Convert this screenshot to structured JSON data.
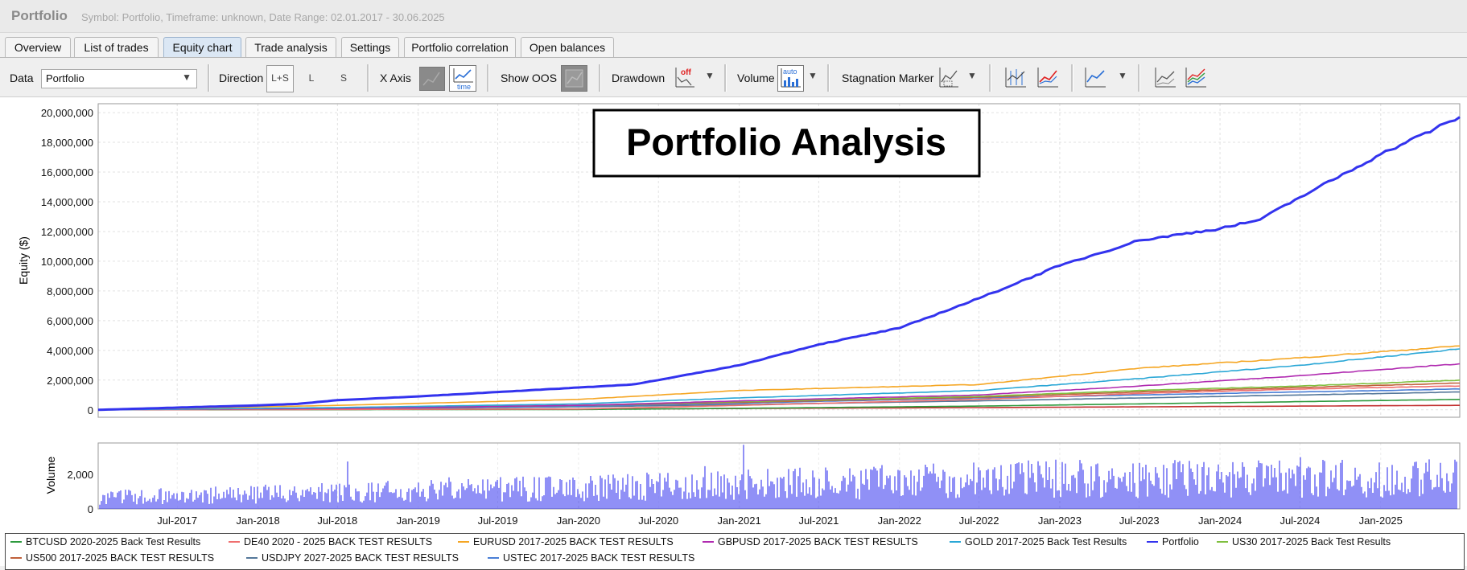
{
  "window": {
    "title": "Portfolio",
    "subtitle": "Symbol: Portfolio, Timeframe: unknown, Date Range: 02.01.2017 - 30.06.2025"
  },
  "tabs": [
    {
      "label": "Overview"
    },
    {
      "label": "List of trades"
    },
    {
      "label": "Equity chart",
      "active": true
    },
    {
      "label": "Trade analysis"
    },
    {
      "label": "Settings"
    },
    {
      "label": "Portfolio correlation"
    },
    {
      "label": "Open balances"
    }
  ],
  "toolbar": {
    "data_label": "Data",
    "data_value": "Portfolio",
    "direction_label": "Direction",
    "direction_options": [
      "L+S",
      "L",
      "S"
    ],
    "direction_selected": "L+S",
    "xaxis_label": "X Axis",
    "show_oos_label": "Show OOS",
    "drawdown_label": "Drawdown",
    "drawdown_badge": "off",
    "volume_label": "Volume",
    "volume_badge": "auto",
    "stagnation_label": "Stagnation Marker",
    "xaxis_time_badge": "time"
  },
  "chart": {
    "overlay_title": "Portfolio Analysis",
    "ylabel": "Equity ($)",
    "volume_label": "Volume",
    "accent": "#3333ee"
  },
  "chart_data": [
    {
      "type": "line",
      "title": "",
      "xlabel": "",
      "ylabel": "Equity ($)",
      "x_range": [
        "2017-01-02",
        "2025-06-30"
      ],
      "ylim": [
        -500000,
        20600000
      ],
      "grid": true,
      "y_ticks": [
        "20,000,000",
        "18,000,000",
        "16,000,000",
        "14,000,000",
        "12,000,000",
        "10,000,000",
        "8,000,000",
        "6,000,000",
        "4,000,000",
        "2,000,000",
        "0"
      ],
      "x_ticks": [
        "Jul-2017",
        "Jan-2018",
        "Jul-2018",
        "Jan-2019",
        "Jul-2019",
        "Jan-2020",
        "Jul-2020",
        "Jan-2021",
        "Jul-2021",
        "Jan-2022",
        "Jul-2022",
        "Jan-2023",
        "Jul-2023",
        "Jan-2024",
        "Jul-2024",
        "Jan-2025"
      ],
      "legend_position": "bottom",
      "series": [
        {
          "name": "Portfolio",
          "color": "#3333ee",
          "x": [
            "2017-01-02",
            "2017-07-01",
            "2018-01-01",
            "2018-04-01",
            "2018-07-01",
            "2019-01-01",
            "2019-07-01",
            "2020-01-01",
            "2020-05-01",
            "2020-07-01",
            "2021-01-01",
            "2021-04-01",
            "2021-07-01",
            "2022-01-01",
            "2022-07-01",
            "2023-01-01",
            "2023-07-01",
            "2024-01-01",
            "2024-04-01",
            "2024-07-01",
            "2025-01-01",
            "2025-06-30"
          ],
          "y": [
            0,
            150000,
            300000,
            400000,
            650000,
            900000,
            1200000,
            1500000,
            1700000,
            2000000,
            3000000,
            3700000,
            4400000,
            5500000,
            7500000,
            9700000,
            11400000,
            12200000,
            12800000,
            14300000,
            17200000,
            19700000
          ]
        },
        {
          "name": "EURUSD 2017-2025 BACK TEST RESULTS",
          "color": "#f5a623",
          "x": [
            "2017-01-02",
            "2018-07-01",
            "2020-01-01",
            "2021-01-01",
            "2022-07-01",
            "2023-07-01",
            "2024-07-01",
            "2025-06-30"
          ],
          "y": [
            0,
            300000,
            700000,
            1300000,
            1700000,
            2800000,
            3500000,
            4300000
          ]
        },
        {
          "name": "GOLD 2017-2025 Back Test Results",
          "color": "#2aa7d6",
          "x": [
            "2017-01-02",
            "2018-07-01",
            "2020-01-01",
            "2021-01-01",
            "2022-07-01",
            "2023-07-01",
            "2024-07-01",
            "2025-06-30"
          ],
          "y": [
            0,
            150000,
            400000,
            800000,
            1300000,
            2100000,
            3000000,
            4100000
          ]
        },
        {
          "name": "GBPUSD 2017-2025 BACK TEST RESULTS",
          "color": "#b02ab0",
          "x": [
            "2017-01-02",
            "2018-07-01",
            "2020-01-01",
            "2021-01-01",
            "2022-07-01",
            "2023-07-01",
            "2024-07-01",
            "2025-06-30"
          ],
          "y": [
            0,
            100000,
            300000,
            600000,
            1000000,
            1600000,
            2300000,
            3100000
          ]
        },
        {
          "name": "US30 2017-2025 Back Test Results",
          "color": "#7fbf3f",
          "x": [
            "2017-01-02",
            "2018-07-01",
            "2020-01-01",
            "2021-01-01",
            "2022-07-01",
            "2023-07-01",
            "2024-07-01",
            "2025-06-30"
          ],
          "y": [
            0,
            100000,
            300000,
            550000,
            900000,
            1300000,
            1600000,
            2000000
          ]
        },
        {
          "name": "US500 2017-2025 BACK TEST RESULTS",
          "color": "#c0603a",
          "x": [
            "2017-01-02",
            "2018-07-01",
            "2020-01-01",
            "2021-01-01",
            "2022-07-01",
            "2023-07-01",
            "2024-07-01",
            "2025-06-30"
          ],
          "y": [
            0,
            100000,
            300000,
            500000,
            850000,
            1200000,
            1500000,
            1800000
          ]
        },
        {
          "name": "DE40 2020 - 2025 BACK TEST RESULTS",
          "color": "#ef6f6f",
          "x": [
            "2017-01-02",
            "2020-01-01",
            "2021-01-01",
            "2022-07-01",
            "2023-07-01",
            "2024-07-01",
            "2025-06-30"
          ],
          "y": [
            0,
            50000,
            300000,
            700000,
            1100000,
            1400000,
            1600000
          ]
        },
        {
          "name": "USTEC 2017-2025 BACK TEST RESULTS",
          "color": "#4a7fd6",
          "x": [
            "2017-01-02",
            "2018-07-01",
            "2020-01-01",
            "2021-01-01",
            "2022-07-01",
            "2023-07-01",
            "2024-07-01",
            "2025-06-30"
          ],
          "y": [
            0,
            80000,
            250000,
            450000,
            800000,
            1000000,
            1200000,
            1400000
          ]
        },
        {
          "name": "USDJPY 2027-2025 BACK TEST RESULTS",
          "color": "#55789a",
          "x": [
            "2017-01-02",
            "2018-07-01",
            "2020-01-01",
            "2021-01-01",
            "2022-07-01",
            "2023-07-01",
            "2024-07-01",
            "2025-06-30"
          ],
          "y": [
            0,
            60000,
            200000,
            350000,
            600000,
            800000,
            1000000,
            1200000
          ]
        },
        {
          "name": "BTCUSD 2020-2025 Back Test Results",
          "color": "#2e9a3e",
          "x": [
            "2017-01-02",
            "2020-01-01",
            "2021-01-01",
            "2022-07-01",
            "2023-07-01",
            "2024-07-01",
            "2025-06-30"
          ],
          "y": [
            0,
            20000,
            100000,
            250000,
            400000,
            550000,
            700000
          ]
        },
        {
          "name": "",
          "color": "#c23030",
          "x": [
            "2017-01-02",
            "2020-01-01",
            "2022-07-01",
            "2025-06-30"
          ],
          "y": [
            0,
            50000,
            150000,
            300000
          ]
        }
      ]
    },
    {
      "type": "bar",
      "ylabel": "Volume",
      "ylim": [
        0,
        3800
      ],
      "y_ticks": [
        "2,000",
        "0"
      ],
      "color": "#2222ee",
      "x_range": [
        "2017-01-02",
        "2025-06-30"
      ],
      "typical_range": [
        400,
        2500
      ],
      "peak": 3700
    }
  ],
  "legend": [
    {
      "label": "BTCUSD 2020-2025 Back Test Results",
      "color": "#2e9a3e"
    },
    {
      "label": "DE40 2020 - 2025 BACK TEST RESULTS",
      "color": "#ef6f6f"
    },
    {
      "label": "EURUSD 2017-2025 BACK TEST RESULTS",
      "color": "#f5a623"
    },
    {
      "label": "GBPUSD 2017-2025 BACK TEST RESULTS",
      "color": "#b02ab0"
    },
    {
      "label": "GOLD 2017-2025 Back Test Results",
      "color": "#2aa7d6"
    },
    {
      "label": "Portfolio",
      "color": "#3333ee"
    },
    {
      "label": "US30 2017-2025 Back Test Results",
      "color": "#7fbf3f"
    },
    {
      "label": "US500 2017-2025 BACK TEST RESULTS",
      "color": "#c0603a"
    },
    {
      "label": "USDJPY 2027-2025 BACK TEST RESULTS",
      "color": "#55789a"
    },
    {
      "label": "USTEC 2017-2025 BACK TEST RESULTS",
      "color": "#4a7fd6"
    }
  ]
}
